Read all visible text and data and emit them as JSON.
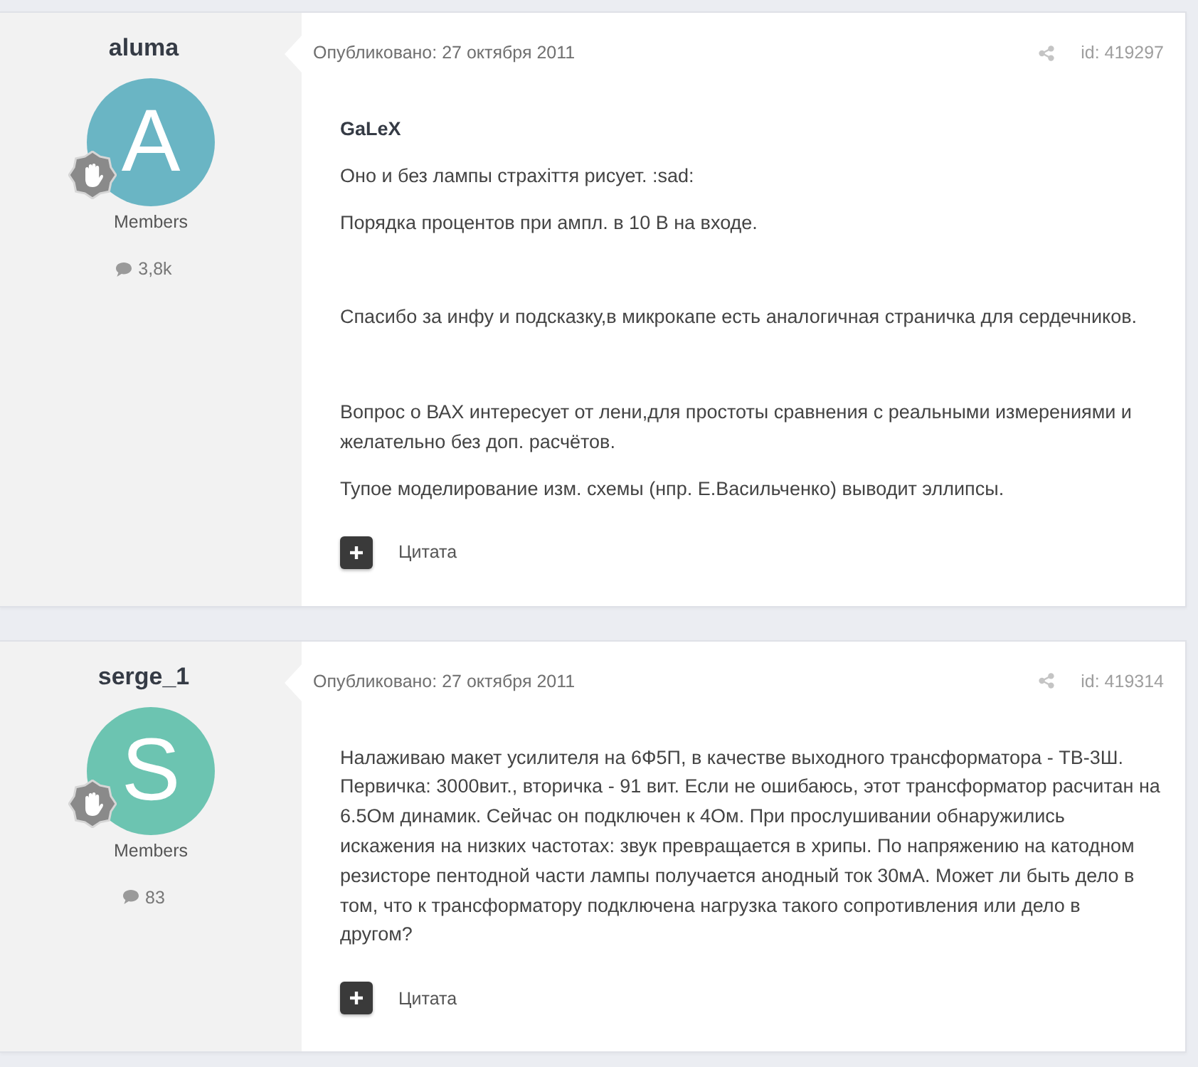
{
  "posts": [
    {
      "author": {
        "name": "aluma",
        "initial": "A",
        "color": "#6ab5c4",
        "group": "Members",
        "post_count": "3,8k"
      },
      "published": "Опубликовано: 27 октября 2011",
      "post_id": "id: 419297",
      "mention": "GaLeX",
      "sections": [
        [
          "Оно и без лампы страхіття рисует. :sad:",
          "Порядка процентов при ампл. в 10 В на входе."
        ],
        [
          "Спасибо за инфу и подсказку,в микрокапе есть аналогичная страничка для сердечников."
        ],
        [
          "Вопрос о ВАХ интересует от лени,для простоты сравнения с реальными измерениями и желательно без доп. расчётов.",
          "Тупое моделирование изм. схемы (нпр. Е.Васильченко) выводит эллипсы."
        ]
      ],
      "quote_label": "Цитата"
    },
    {
      "author": {
        "name": "serge_1",
        "initial": "S",
        "color": "#6cc4b1",
        "group": "Members",
        "post_count": "83"
      },
      "published": "Опубликовано: 27 октября 2011",
      "post_id": "id: 419314",
      "sections": [
        [
          "Налаживаю макет усилителя на 6Ф5П, в качестве выходного трансформатора - ТВ-3Ш. Первичка: 3000вит., вторичка - 91 вит. Если не ошибаюсь, этот трансформатор расчитан на 6.5Ом динамик. Сейчас он подключен к 4Ом. При прослушивании обнаружились\nискажения на низких частотах: звук превращается в хрипы. По напряжению на катодном резисторе пентодной части лампы получается анодный ток 30мА. Может ли быть дело в том, что к трансформатору подключена нагрузка такого сопротивления или дело в\nдругом?"
        ]
      ],
      "quote_label": "Цитата"
    }
  ]
}
